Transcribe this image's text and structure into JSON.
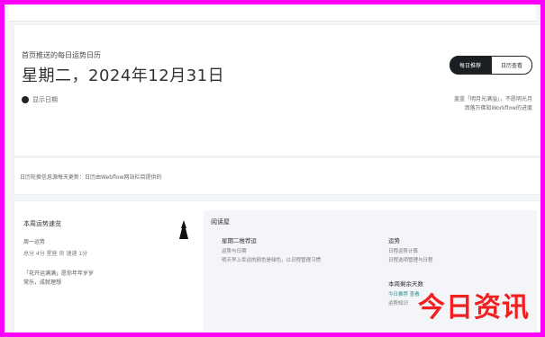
{
  "header": {
    "subtitle": "首页推送的每日运势日历",
    "date": "星期二，2024年12月31日",
    "meta": "显示日期"
  },
  "actions": {
    "primary": "每日推荐",
    "secondary": "日历查看"
  },
  "quote": {
    "line1": "盖蓝「明月光满溢」，不愿明光月",
    "line2": "洒落万佛知Workflow的进度"
  },
  "band": {
    "text": "日历轮换信息源每天更新：日历由Webflow网站栏目提供的"
  },
  "panel_left": {
    "title": "本周运势速览",
    "sub": "周一运势",
    "desc": "总分 4分 星座 良 速递 1分",
    "quote_line1": "「花开运满满」愿你年年岁岁",
    "quote_line2": "常乐，成就理想"
  },
  "panel_right": {
    "header": "阅读屋",
    "item1": {
      "title": "星期二推荐运",
      "line1": "运势与日期",
      "line2": "明天早上幸运的颜色是绿色，以日程管理习惯"
    },
    "item2": {
      "title": "运势",
      "line1": "日程运势计算",
      "line2": "日程选项管理与日程"
    },
    "item3": {
      "title": "本周剩余天数",
      "line1": "今日推荐 查看",
      "line2": "运势知识"
    }
  },
  "watermark": "今日资讯",
  "colors": {
    "border": "#ff00ff",
    "watermark": "#f02020",
    "primary_button": "#1b1f24",
    "accent_text": "#2c8b8b"
  },
  "icons": [
    "circle-icon",
    "figure-icon"
  ]
}
